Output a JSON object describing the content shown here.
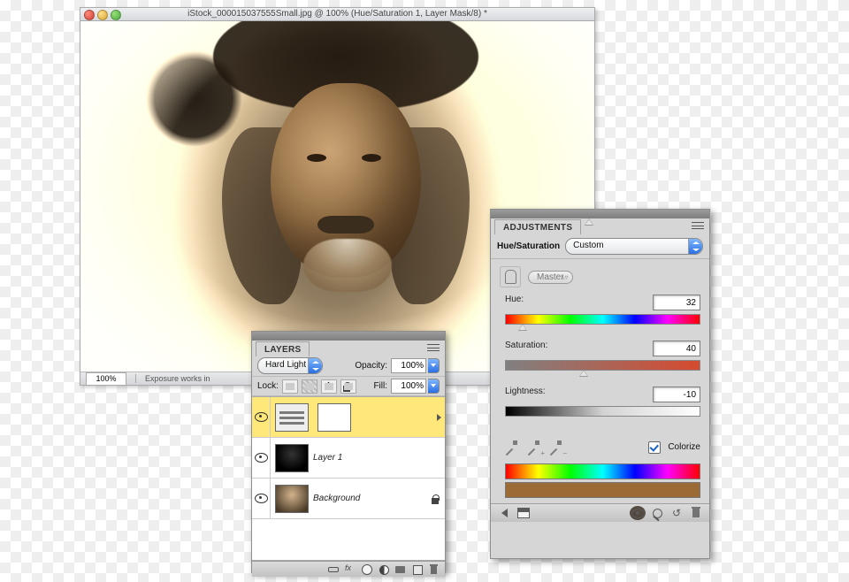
{
  "document": {
    "title": "iStock_000015037555Small.jpg @ 100% (Hue/Saturation 1, Layer Mask/8) *",
    "zoom": "100%",
    "status_hint": "Exposure works in"
  },
  "layers_panel": {
    "tab_label": "LAYERS",
    "blend_mode": "Hard Light",
    "opacity_label": "Opacity:",
    "opacity_value": "100%",
    "lock_label": "Lock:",
    "fill_label": "Fill:",
    "fill_value": "100%",
    "layers": [
      {
        "name": "",
        "icon": "hue-sat-adjustment",
        "selected": true,
        "has_mask": true
      },
      {
        "name": "Layer 1",
        "icon": "texture",
        "selected": false,
        "has_mask": false
      },
      {
        "name": "Background",
        "icon": "photo",
        "selected": false,
        "has_mask": false,
        "locked": true
      }
    ],
    "footer_icons": [
      "link",
      "fx",
      "mask",
      "adjustment",
      "group",
      "new",
      "trash"
    ]
  },
  "adjustments_panel": {
    "tab_label": "ADJUSTMENTS",
    "type_label": "Hue/Saturation",
    "preset": "Custom",
    "range_label": "Master",
    "hue_label": "Hue:",
    "hue_value": "32",
    "sat_label": "Saturation:",
    "sat_value": "40",
    "light_label": "Lightness:",
    "light_value": "-10",
    "colorize_label": "Colorize",
    "colorize_checked": true,
    "footer_icons": [
      "back",
      "toggle",
      "eye",
      "view-previous",
      "reset",
      "trash"
    ]
  },
  "colors": {
    "panel_bg": "#d6d6d6",
    "selection": "#ffe879",
    "aqua": "#2a6fe3",
    "result": "#9b6a35"
  }
}
